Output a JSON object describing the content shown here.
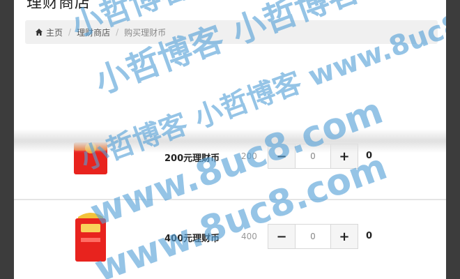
{
  "page": {
    "title": "理财商店"
  },
  "breadcrumb": {
    "home": "主页",
    "separator": "/",
    "shop": "理财商店",
    "current": "购买理财币"
  },
  "products": [
    {
      "name": "200元理财币",
      "price": "200",
      "quantity": "0",
      "subtotal": "0",
      "minus_label": "−",
      "plus_label": "+",
      "image_color": "#e8231e"
    },
    {
      "name": "400元理财币",
      "price": "400",
      "quantity": "0",
      "subtotal": "0",
      "minus_label": "−",
      "plus_label": "+",
      "image_color": "#e8231e",
      "image_text": "¥400"
    }
  ],
  "watermarks": [
    "小哲博客 小哲博客",
    "小哲博客 小哲博客 www.8uc8.com",
    "www.8uc8.com",
    "www.8uc8.com",
    "小哲博客 小哲博客"
  ],
  "colors": {
    "watermark": "#54a0d6",
    "breadcrumb_bg": "#f0f0f0",
    "red_packet": "#e8231e"
  }
}
